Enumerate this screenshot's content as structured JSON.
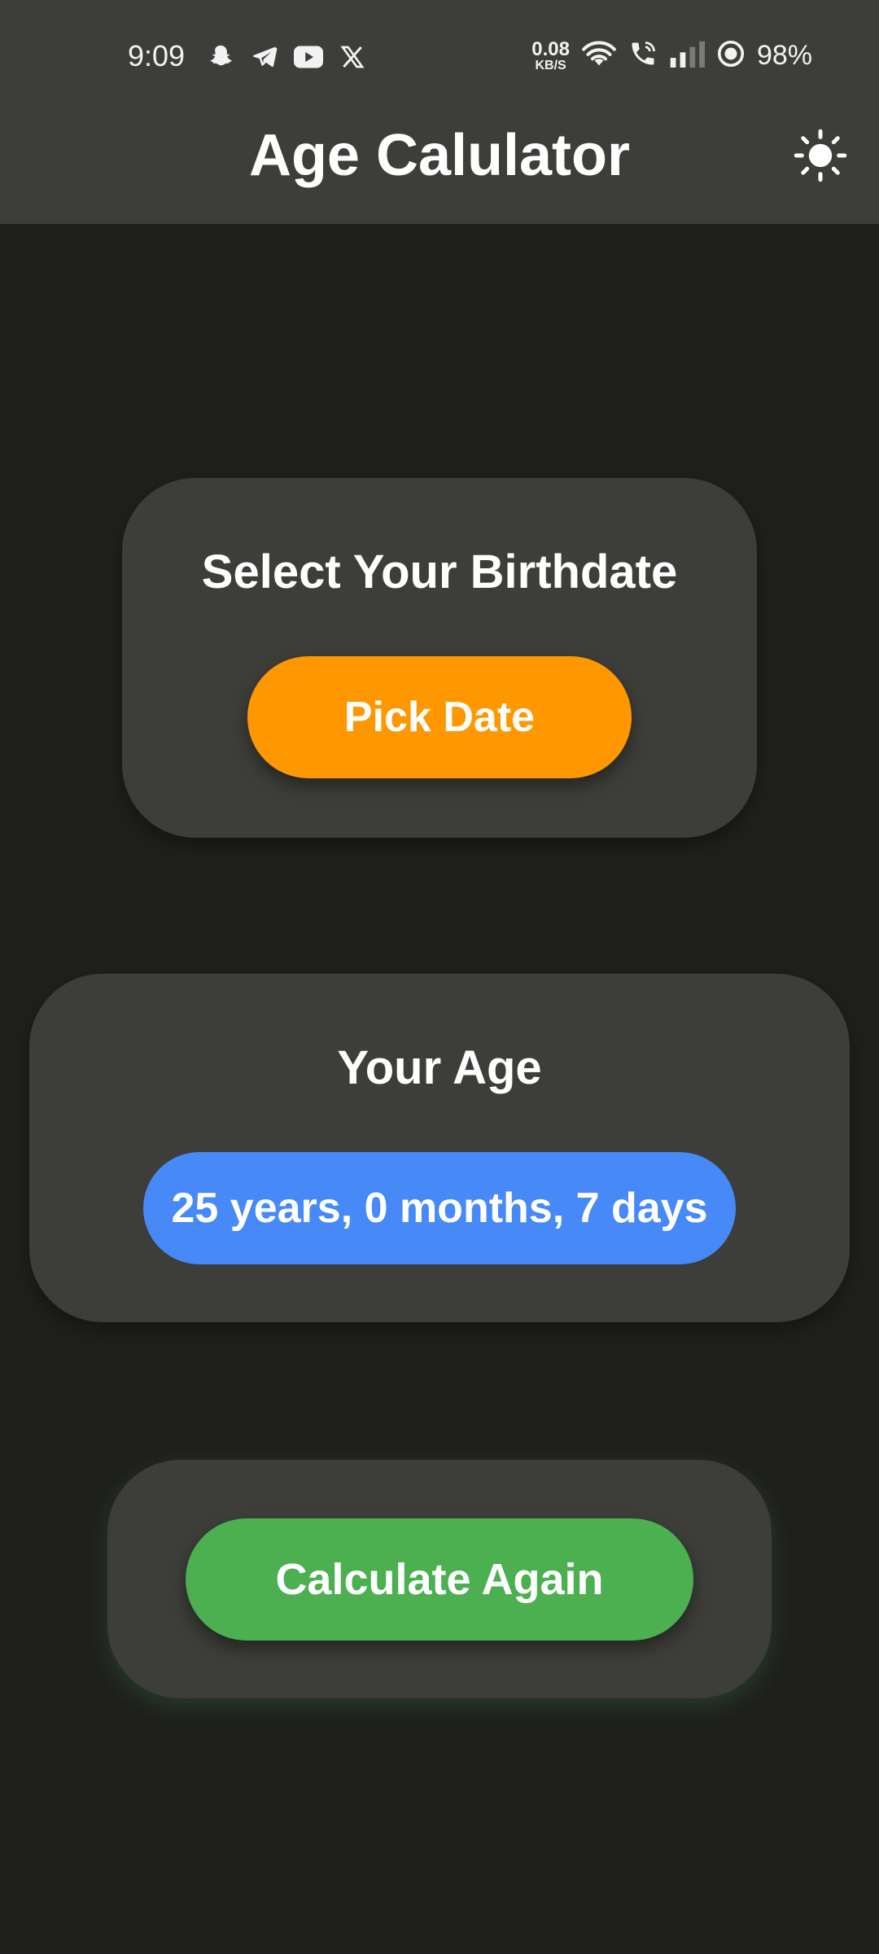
{
  "status_bar": {
    "time": "9:09",
    "notification_icons": [
      "snapchat-icon",
      "telegram-icon",
      "youtube-icon",
      "x-icon"
    ],
    "net_speed_value": "0.08",
    "net_speed_unit": "KB/S",
    "battery": "98%"
  },
  "app_bar": {
    "title": "Age Calulator",
    "theme_icon": "sun-icon"
  },
  "birthdate_card": {
    "heading": "Select Your Birthdate",
    "button_label": "Pick Date"
  },
  "age_card": {
    "heading": "Your Age",
    "result": "25 years, 0 months, 7 days"
  },
  "again_card": {
    "button_label": "Calculate Again"
  },
  "colors": {
    "background": "#1f201e",
    "surface": "#3d3d39",
    "pick_button": "#ff9800",
    "age_pill": "#4689f7",
    "again_button": "#4caf50"
  }
}
